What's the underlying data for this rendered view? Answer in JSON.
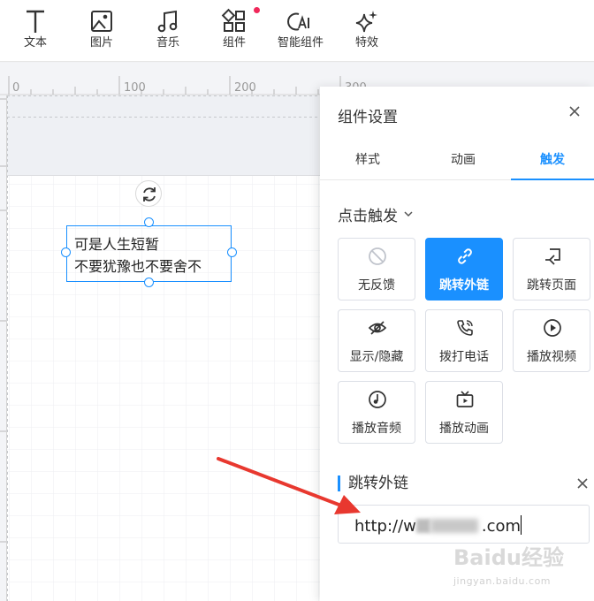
{
  "toolbar": {
    "items": [
      {
        "label": "文本",
        "icon": "text-icon"
      },
      {
        "label": "图片",
        "icon": "image-icon"
      },
      {
        "label": "音乐",
        "icon": "music-icon"
      },
      {
        "label": "组件",
        "icon": "components-icon",
        "has_dot": true
      },
      {
        "label": "智能组件",
        "icon": "ai-icon"
      },
      {
        "label": "特效",
        "icon": "sparkle-icon"
      }
    ]
  },
  "ruler": {
    "ticks": [
      "0",
      "100",
      "200",
      "300"
    ]
  },
  "canvas": {
    "text_lines": [
      "可是人生短暂",
      "不要犹豫也不要舍不"
    ]
  },
  "panel": {
    "title": "组件设置",
    "tabs": [
      {
        "label": "样式",
        "active": false
      },
      {
        "label": "动画",
        "active": false
      },
      {
        "label": "触发",
        "active": true
      }
    ],
    "trigger_label": "点击触发",
    "actions": [
      {
        "label": "无反馈",
        "icon": "ban-icon",
        "active": false
      },
      {
        "label": "跳转外链",
        "icon": "link-icon",
        "active": true
      },
      {
        "label": "跳转页面",
        "icon": "page-jump-icon",
        "active": false
      },
      {
        "label": "显示/隐藏",
        "icon": "eye-hide-icon",
        "active": false
      },
      {
        "label": "拨打电话",
        "icon": "phone-icon",
        "active": false
      },
      {
        "label": "播放视频",
        "icon": "play-circle-icon",
        "active": false
      },
      {
        "label": "播放音频",
        "icon": "music-disc-icon",
        "active": false
      },
      {
        "label": "播放动画",
        "icon": "tv-icon",
        "active": false
      }
    ],
    "section_title": "跳转外链",
    "url_prefix": "http://w",
    "url_suffix": ".com"
  },
  "watermark": {
    "brand": "Baidu经验",
    "sub": "jingyan.baidu.com"
  },
  "colors": {
    "accent": "#1a90ff",
    "dot": "#f0285a",
    "arrow": "#e8382f"
  }
}
